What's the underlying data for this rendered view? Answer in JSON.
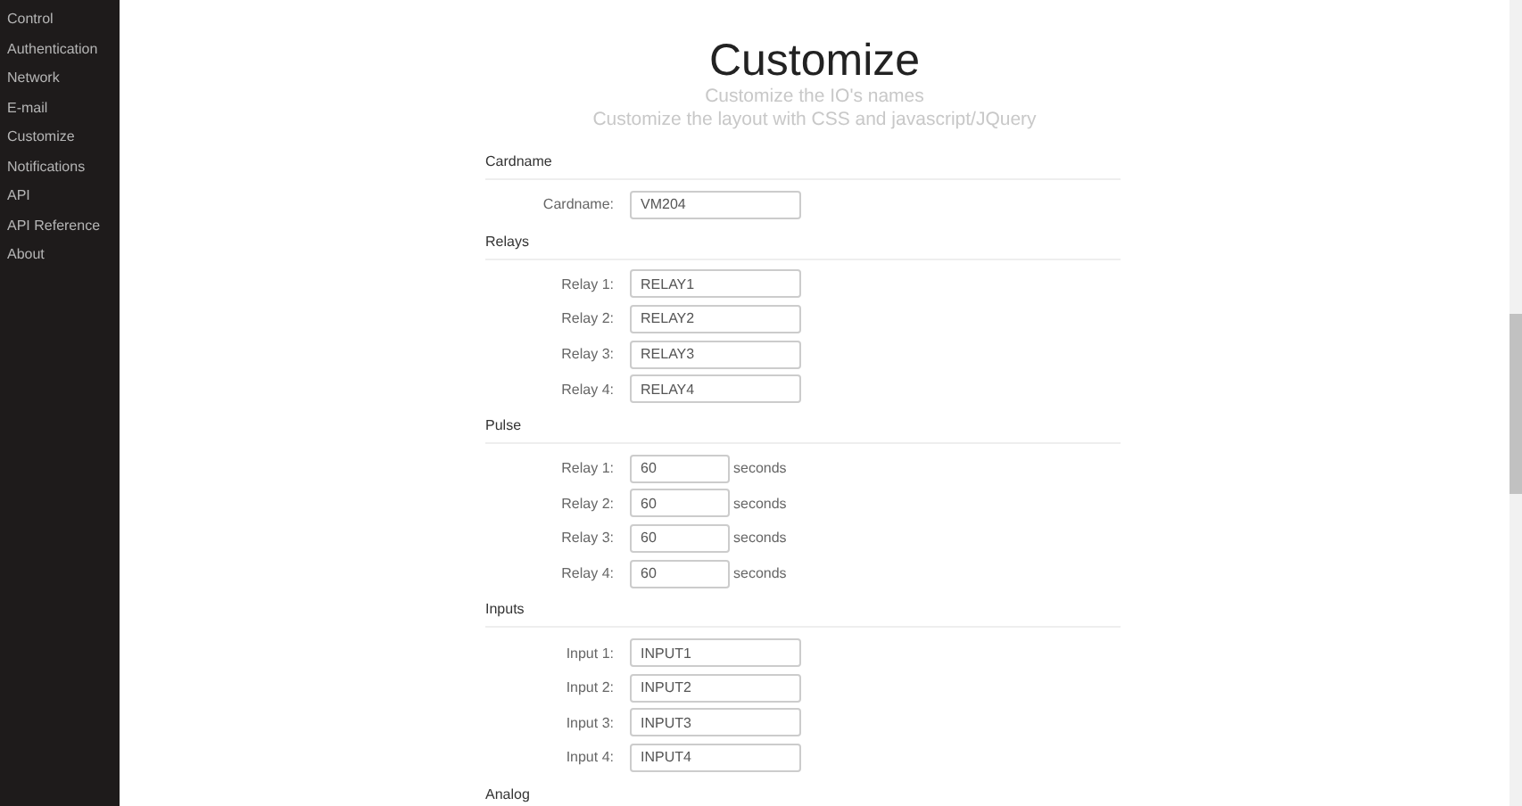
{
  "sidebar": {
    "items": [
      {
        "label": "Control"
      },
      {
        "label": "Authentication"
      },
      {
        "label": "Network"
      },
      {
        "label": "E-mail"
      },
      {
        "label": "Customize"
      },
      {
        "label": "Notifications"
      },
      {
        "label": "API"
      },
      {
        "label": "API Reference"
      },
      {
        "label": "About"
      }
    ]
  },
  "header": {
    "title": "Customize",
    "subtitles": [
      "Customize the IO's names",
      "Customize the layout with CSS and javascript/JQuery"
    ]
  },
  "sections": [
    {
      "title": "Cardname",
      "kind": "text",
      "rows": [
        {
          "label": "Cardname:",
          "value": "VM204"
        }
      ]
    },
    {
      "title": "Relays",
      "kind": "text",
      "rows": [
        {
          "label": "Relay 1:",
          "value": "RELAY1"
        },
        {
          "label": "Relay 2:",
          "value": "RELAY2"
        },
        {
          "label": "Relay 3:",
          "value": "RELAY3"
        },
        {
          "label": "Relay 4:",
          "value": "RELAY4"
        }
      ]
    },
    {
      "title": "Pulse",
      "kind": "seconds",
      "rows": [
        {
          "label": "Relay 1:",
          "value": "60",
          "unit": "seconds"
        },
        {
          "label": "Relay 2:",
          "value": "60",
          "unit": "seconds"
        },
        {
          "label": "Relay 3:",
          "value": "60",
          "unit": "seconds"
        },
        {
          "label": "Relay 4:",
          "value": "60",
          "unit": "seconds"
        }
      ]
    },
    {
      "title": "Inputs",
      "kind": "text",
      "rows": [
        {
          "label": "Input 1:",
          "value": "INPUT1"
        },
        {
          "label": "Input 2:",
          "value": "INPUT2"
        },
        {
          "label": "Input 3:",
          "value": "INPUT3"
        },
        {
          "label": "Input 4:",
          "value": "INPUT4"
        }
      ]
    },
    {
      "title": "Analog"
    }
  ]
}
